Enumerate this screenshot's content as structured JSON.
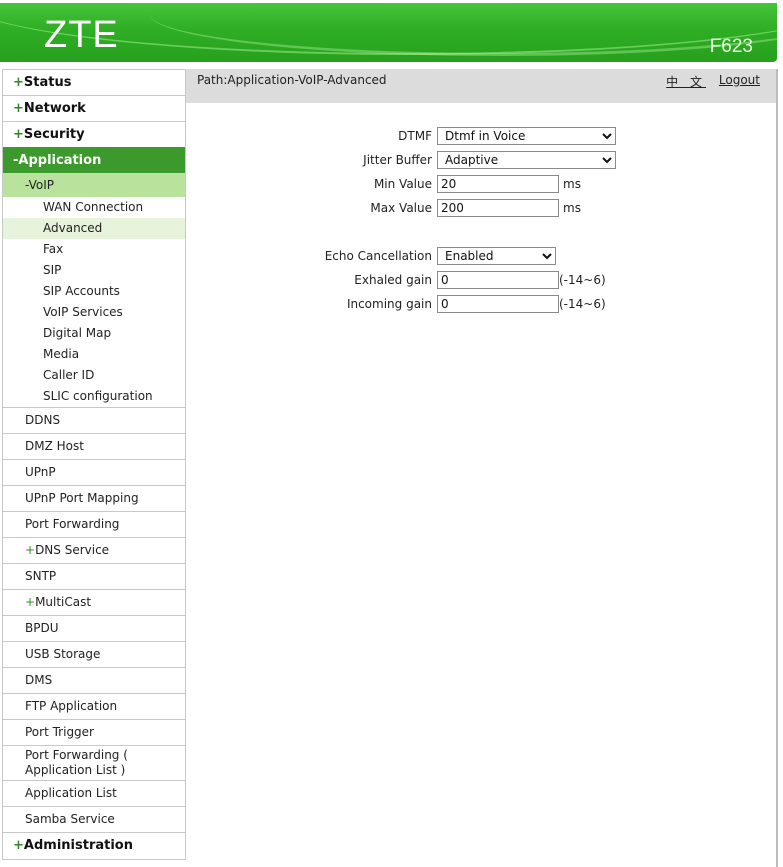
{
  "header": {
    "logo": "ZTE",
    "model": "F623"
  },
  "sidebar": {
    "top": [
      {
        "sign": "+",
        "label": "Status"
      },
      {
        "sign": "+",
        "label": "Network"
      },
      {
        "sign": "+",
        "label": "Security"
      },
      {
        "sign": "-",
        "label": "Application"
      }
    ],
    "voip": {
      "label": "-VoIP"
    },
    "voip_items": [
      "WAN Connection",
      "Advanced",
      "Fax",
      "SIP",
      "SIP Accounts",
      "VoIP Services",
      "Digital Map",
      "Media",
      "Caller ID",
      "SLIC configuration"
    ],
    "app_items": [
      {
        "sign": "",
        "label": "DDNS"
      },
      {
        "sign": "",
        "label": "DMZ Host"
      },
      {
        "sign": "",
        "label": "UPnP"
      },
      {
        "sign": "",
        "label": "UPnP Port Mapping"
      },
      {
        "sign": "",
        "label": "Port Forwarding"
      },
      {
        "sign": "+",
        "label": "DNS Service"
      },
      {
        "sign": "",
        "label": "SNTP"
      },
      {
        "sign": "+",
        "label": "MultiCast"
      },
      {
        "sign": "",
        "label": "BPDU"
      },
      {
        "sign": "",
        "label": "USB Storage"
      },
      {
        "sign": "",
        "label": "DMS"
      },
      {
        "sign": "",
        "label": "FTP Application"
      },
      {
        "sign": "",
        "label": "Port Trigger"
      },
      {
        "sign": "",
        "label": "Port Forwarding ( Application List )"
      },
      {
        "sign": "",
        "label": "Application List"
      },
      {
        "sign": "",
        "label": "Samba Service"
      }
    ],
    "bottom": {
      "sign": "+",
      "label": "Administration"
    },
    "active_top": "Application",
    "active_sub": "Advanced"
  },
  "topbar": {
    "path": "Path:Application-VoIP-Advanced",
    "language_link": "中 文",
    "logout": "Logout"
  },
  "form": {
    "dtmf": {
      "label": "DTMF",
      "value": "Dtmf in Voice"
    },
    "jitter_buffer": {
      "label": "Jitter Buffer",
      "value": "Adaptive"
    },
    "min_value": {
      "label": "Min Value",
      "value": "20",
      "unit": "ms"
    },
    "max_value": {
      "label": "Max Value",
      "value": "200",
      "unit": "ms"
    },
    "echo_cancellation": {
      "label": "Echo Cancellation",
      "value": "Enabled"
    },
    "exhaled_gain": {
      "label": "Exhaled gain",
      "value": "0",
      "range": "(-14~6)"
    },
    "incoming_gain": {
      "label": "Incoming gain",
      "value": "0",
      "range": "(-14~6)"
    }
  },
  "colors": {
    "brand_green": "#2fae25",
    "active_menu": "#3c9a2c",
    "voip_row": "#b9e39d",
    "selected_sub": "#e8f3dc",
    "path_bar": "#dcdcdc"
  }
}
